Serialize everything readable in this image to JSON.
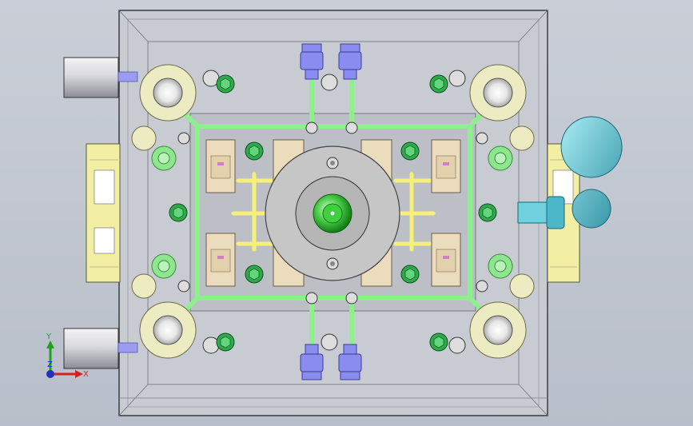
{
  "view": {
    "type": "cad-model-viewport",
    "background": "#c3c8d2"
  },
  "triad": {
    "x_label": "X",
    "y_label": "Y",
    "z_label": "Z",
    "x_color": "#d42020",
    "y_color": "#20a020",
    "z_color": "#2030c0"
  },
  "colors": {
    "plate": "#c6c9cf",
    "plate_edge": "#404448",
    "cooling_green": "#8ff08f",
    "runner_yellow": "#f5ef7a",
    "fitting_blue": "#8a8cf0",
    "eyebolt_teal": "#5cc6d6",
    "bushing_cream": "#ecebc2",
    "screw_green": "#2ca84a",
    "sprue_green": "#31b531"
  }
}
